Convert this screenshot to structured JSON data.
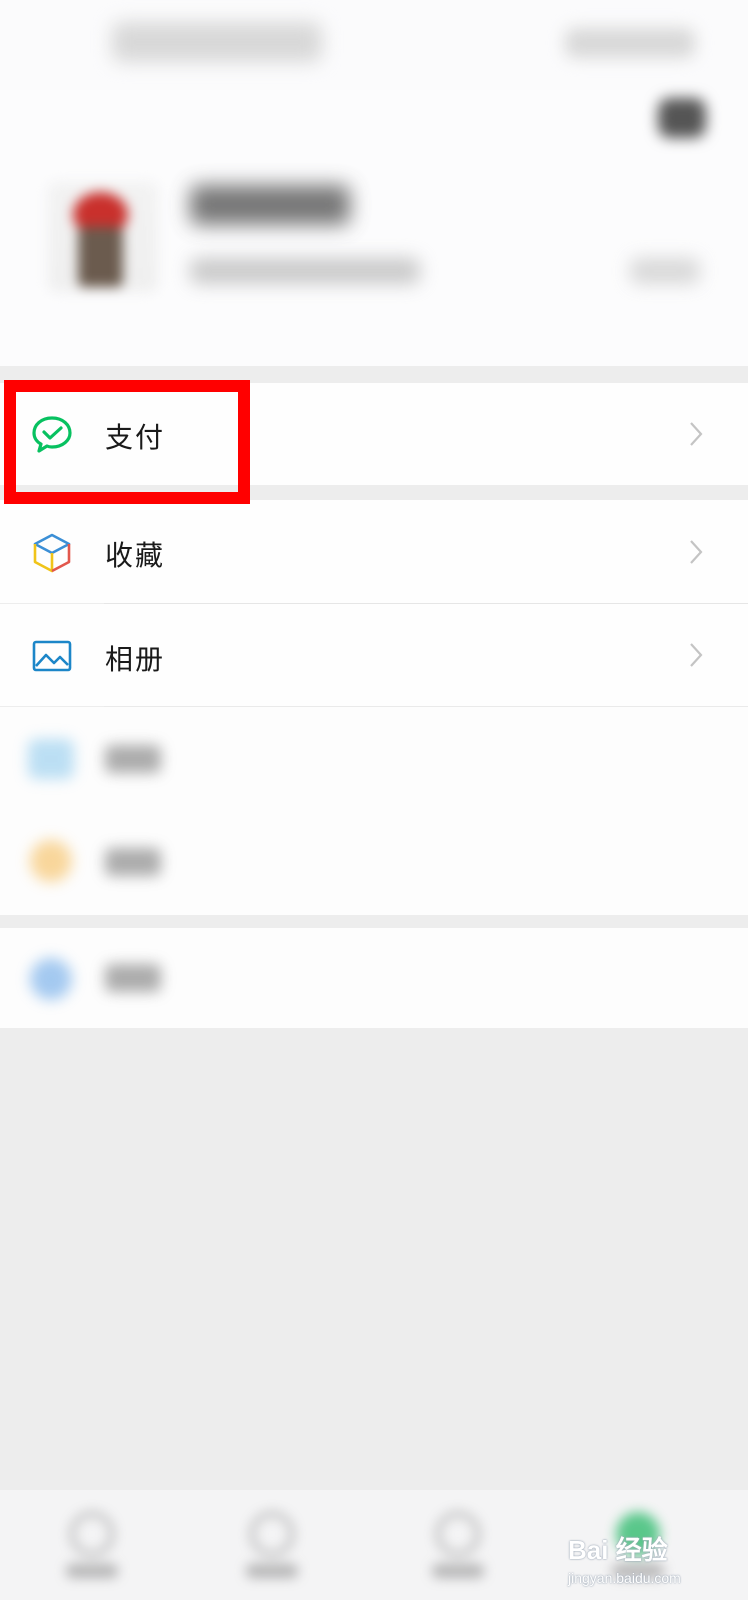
{
  "menu": {
    "pay": {
      "label": "支付",
      "icon": "wechat-pay-icon",
      "color": "#07c160"
    },
    "favorites": {
      "label": "收藏",
      "icon": "cube-icon"
    },
    "album": {
      "label": "相册",
      "icon": "picture-icon",
      "color": "#1c86c8"
    },
    "cards": {
      "icon": "card-icon"
    },
    "stickers": {
      "icon": "emoji-icon"
    },
    "settings": {
      "icon": "settings-icon"
    }
  },
  "highlight": {
    "color": "#ff0000",
    "target": "pay"
  },
  "watermark": {
    "main": "Bai 经验",
    "sub": "jingyan.baidu.com"
  }
}
